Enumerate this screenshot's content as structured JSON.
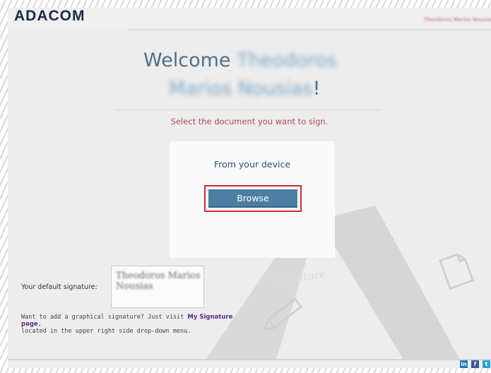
{
  "header": {
    "logo": "ADACOM",
    "user_menu": "Theodoros Marios Nousias"
  },
  "welcome": {
    "greeting": "Welcome",
    "first_name": "Theodoros",
    "last_name": "Marios Nousias",
    "exclaim": "!"
  },
  "instruction": "Select the document you want to sign.",
  "upload": {
    "title": "From your device",
    "browse_label": "Browse"
  },
  "signature": {
    "label": "Your default signature:",
    "name": "Theodoros Marios Nousias",
    "hint_text": "Want to add a graphical signature? Just visit ",
    "hint_link": "My Signature page",
    "hint_suffix": ",",
    "hint_line2": "located in the upper right side drop-down menu."
  },
  "decoration": {
    "watermark_text": "Signature"
  },
  "footer": {
    "social": [
      "in",
      "f",
      "t"
    ]
  },
  "colors": {
    "brand_dark": "#1b2a44",
    "accent_blue": "#4c7ea3",
    "highlight_red": "#d62828",
    "instruction_red": "#b24a4a",
    "link_purple": "#5a2a87"
  }
}
